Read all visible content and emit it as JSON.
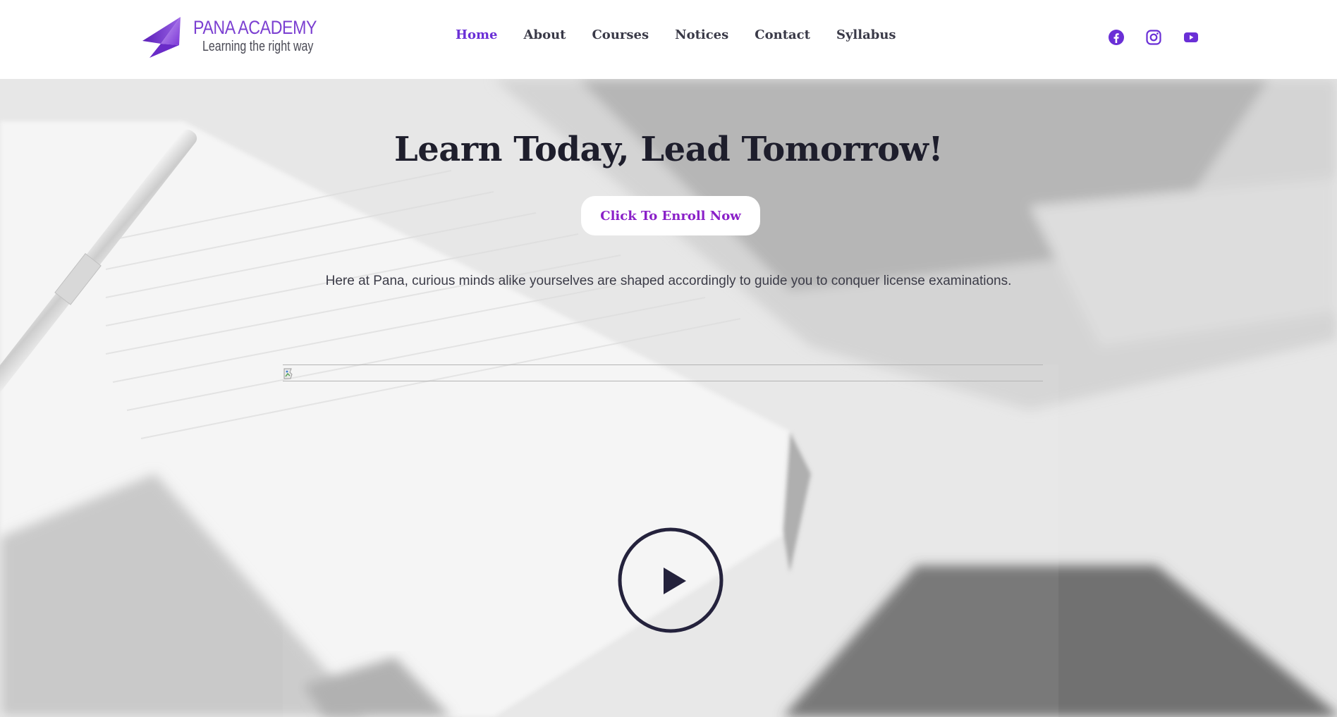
{
  "header": {
    "logo": {
      "title": "PANA ACADEMY",
      "tagline": "Learning the right way"
    },
    "nav": [
      {
        "label": "Home",
        "active": true
      },
      {
        "label": "About",
        "active": false
      },
      {
        "label": "Courses",
        "active": false
      },
      {
        "label": "Notices",
        "active": false
      },
      {
        "label": "Contact",
        "active": false
      },
      {
        "label": "Syllabus",
        "active": false
      }
    ],
    "social": [
      "facebook-icon",
      "instagram-icon",
      "youtube-icon"
    ]
  },
  "hero": {
    "title": "Learn Today, Lead Tomorrow!",
    "enroll_label": "Click To Enroll Now",
    "description": "Here at Pana, curious minds alike yourselves are shaped accordingly to guide you to conquer license examinations."
  },
  "colors": {
    "brand_purple": "#6a2fd6",
    "enroll_text": "#8a1fc8",
    "heading": "#1e1e2c",
    "play_icon": "#24223c"
  }
}
